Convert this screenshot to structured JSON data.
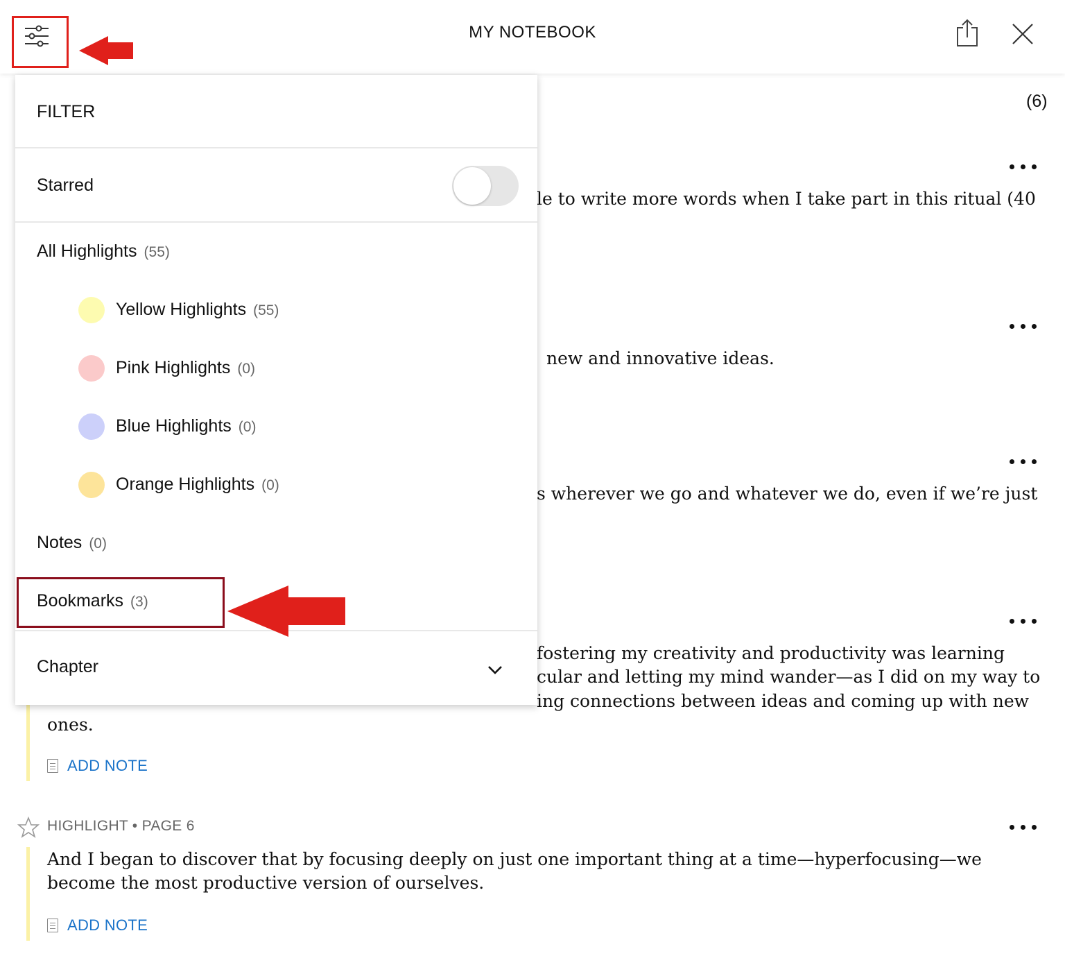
{
  "header": {
    "title": "MY NOTEBOOK",
    "filter_icon": "sliders-icon",
    "share_icon": "share-icon",
    "close_icon": "close-icon"
  },
  "notebook": {
    "count": "(6)",
    "entries": [
      {
        "text_visible": "le to write more words when I take part in this ritual (40"
      },
      {
        "text_visible": "new and innovative ideas."
      },
      {
        "text_visible": "s wherever we go and whatever we do, even if we’re just"
      },
      {
        "lines": [
          "fostering my creativity and productivity was learning",
          "cular and letting my mind wander—as I did on my way to",
          "ing connections between ideas and coming up with new",
          "ones."
        ],
        "add_note": "ADD NOTE"
      },
      {
        "meta": "HIGHLIGHT • PAGE 6",
        "lines": [
          "And I began to discover that by focusing deeply on just one important thing at a time—hyperfocusing—we",
          "become the most productive version of ourselves."
        ],
        "add_note": "ADD NOTE"
      }
    ]
  },
  "filter_panel": {
    "heading": "FILTER",
    "starred": {
      "label": "Starred",
      "enabled": false
    },
    "all_highlights": {
      "label": "All Highlights",
      "count": "(55)"
    },
    "colors": [
      {
        "label": "Yellow Highlights",
        "count": "(55)",
        "color": "#fdfbb0"
      },
      {
        "label": "Pink Highlights",
        "count": "(0)",
        "color": "#fbcaca"
      },
      {
        "label": "Blue Highlights",
        "count": "(0)",
        "color": "#ccd0fa"
      },
      {
        "label": "Orange Highlights",
        "count": "(0)",
        "color": "#fde49a"
      }
    ],
    "notes": {
      "label": "Notes",
      "count": "(0)"
    },
    "bookmarks": {
      "label": "Bookmarks",
      "count": "(3)"
    },
    "chapter": {
      "label": "Chapter"
    }
  },
  "colors": {
    "accent_link": "#1a73c9",
    "highlight_bar": "#fbf1a6",
    "annotation_red": "#e0201b",
    "annotation_dark_red": "#8b0d1c"
  }
}
